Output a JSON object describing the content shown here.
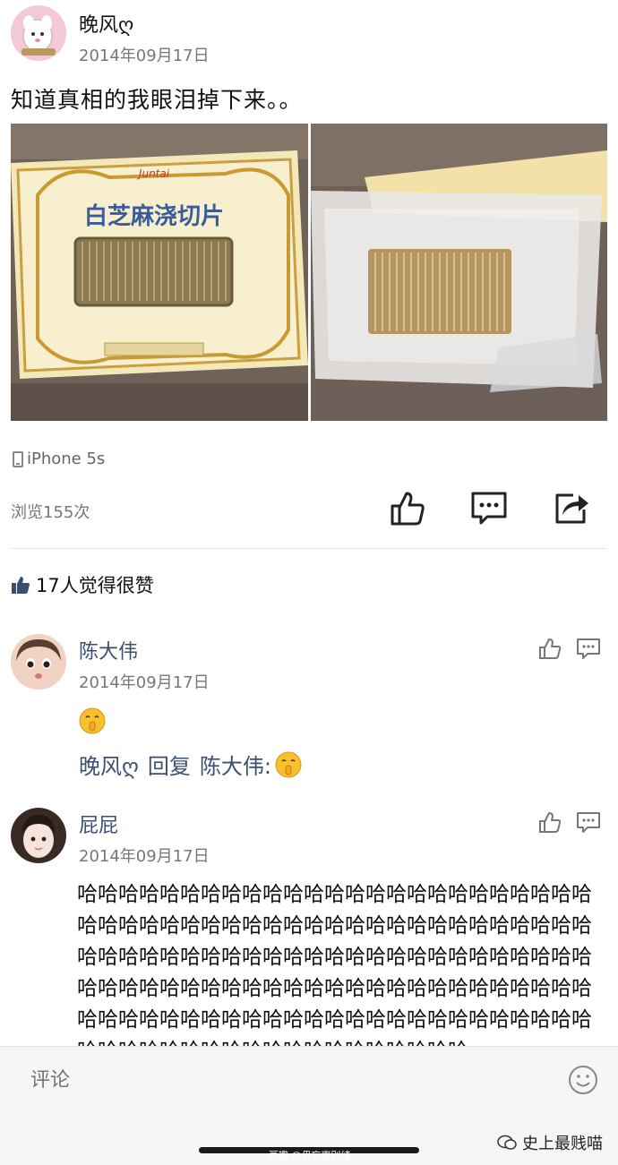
{
  "post": {
    "author": "晚风ღ",
    "date": "2014年09月17日",
    "text": "知道真相的我眼泪掉下来。。",
    "photos": [
      {
        "label": "sesame-snack-box",
        "brand": "Juntai",
        "product_name": "白芝麻浇切片"
      },
      {
        "label": "sesame-snack-in-tray"
      }
    ],
    "device": "iPhone 5s",
    "views": "浏览155次"
  },
  "likes_summary": "17人觉得很赞",
  "comments": [
    {
      "author": "陈大伟",
      "date": "2014年09月17日",
      "emoji": "shush-emoji",
      "reply": {
        "from": "晚风ღ",
        "word": "回复",
        "to": "陈大伟:"
      }
    },
    {
      "author": "屁屁",
      "date": "2014年09月17日",
      "text": "哈哈哈哈哈哈哈哈哈哈哈哈哈哈哈哈哈哈哈哈哈哈哈哈哈哈哈哈哈哈哈哈哈哈哈哈哈哈哈哈哈哈哈哈哈哈哈哈哈哈哈哈哈哈哈哈哈哈哈哈哈哈哈哈哈哈哈哈哈哈哈哈哈哈哈哈哈哈哈哈哈哈哈哈哈哈哈哈哈哈哈哈哈哈哈哈哈哈哈哈哈哈哈哈哈哈哈哈哈哈哈哈哈哈哈哈哈哈哈哈哈哈哈哈哈哈哈哈哈哈哈哈哈哈哈哈哈哈哈哈哈哈哈哈"
    }
  ],
  "comment_bar": {
    "placeholder": "评论"
  },
  "watermark": {
    "small": "豆瓣 @毋忘离别绪",
    "brand": "史上最贱喵"
  },
  "icons": {
    "device": "phone-icon",
    "like": "thumbs-up-icon",
    "comment": "comment-icon",
    "share": "share-icon",
    "emoji": "smiley-icon",
    "wechat": "wechat-icon"
  },
  "colors": {
    "name_link": "#3b4f72",
    "muted": "#777777",
    "bar_bg": "#f6f6f6"
  }
}
